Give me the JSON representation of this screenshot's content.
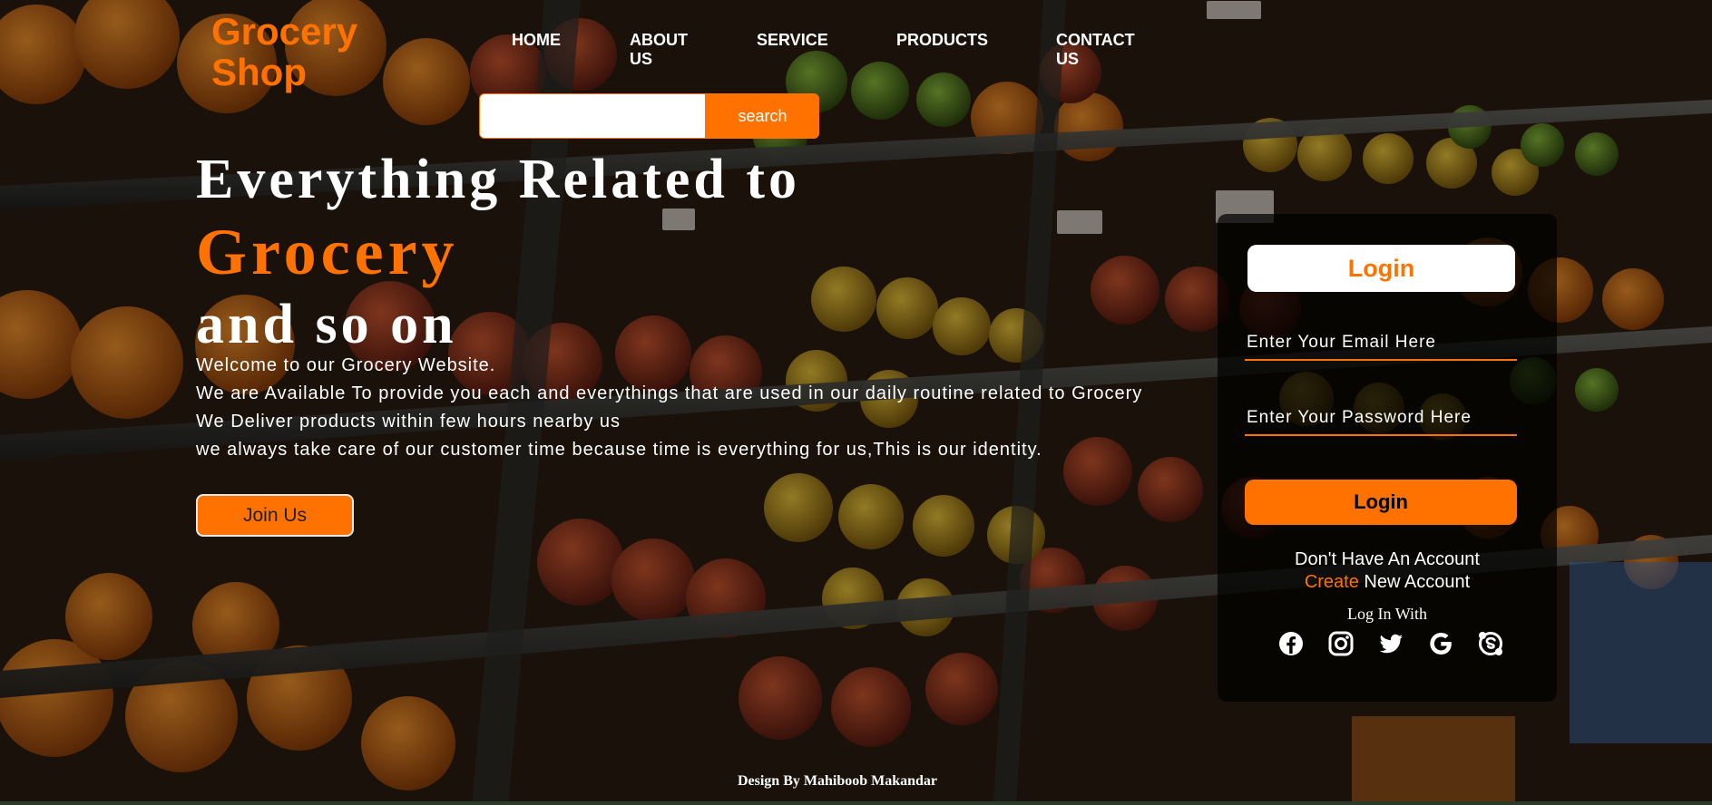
{
  "brand": {
    "line1": "Grocery",
    "line2": "Shop"
  },
  "nav": {
    "home": "HOME",
    "about_1": "ABOUT",
    "about_2": "US",
    "service": "SERVICE",
    "products": "PRODUCTS",
    "contact_1": "CONTACT",
    "contact_2": "US"
  },
  "search": {
    "placeholder": "",
    "button_label": "search"
  },
  "hero": {
    "title_line1": "Everything Related to",
    "title_accent": "Grocery",
    "title_line3": "and so on",
    "paragraph": [
      "Welcome to our Grocery Website.",
      "We are Available To provide you each and everythings that are used in our daily routine related to Grocery",
      "We Deliver products within few hours nearby us",
      "we always take care of our customer time because time is everything for us,This is our identity."
    ],
    "join_label": "Join Us"
  },
  "login": {
    "title": "Login",
    "email_placeholder": "Enter Your Email Here",
    "password_placeholder": "Enter Your Password Here",
    "button_label": "Login",
    "no_account": "Don't Have An Account",
    "create_link": "Create",
    "create_rest": " New Account",
    "login_with": "Log In With",
    "social_icons": [
      "facebook-icon",
      "instagram-icon",
      "twitter-icon",
      "google-icon",
      "skype-icon"
    ]
  },
  "footer": {
    "credit": "Design By Mahiboob Makandar"
  },
  "colors": {
    "accent": "#ff7200",
    "text": "#ffffff",
    "card_bg": "rgba(0,0,0,0.72)"
  }
}
